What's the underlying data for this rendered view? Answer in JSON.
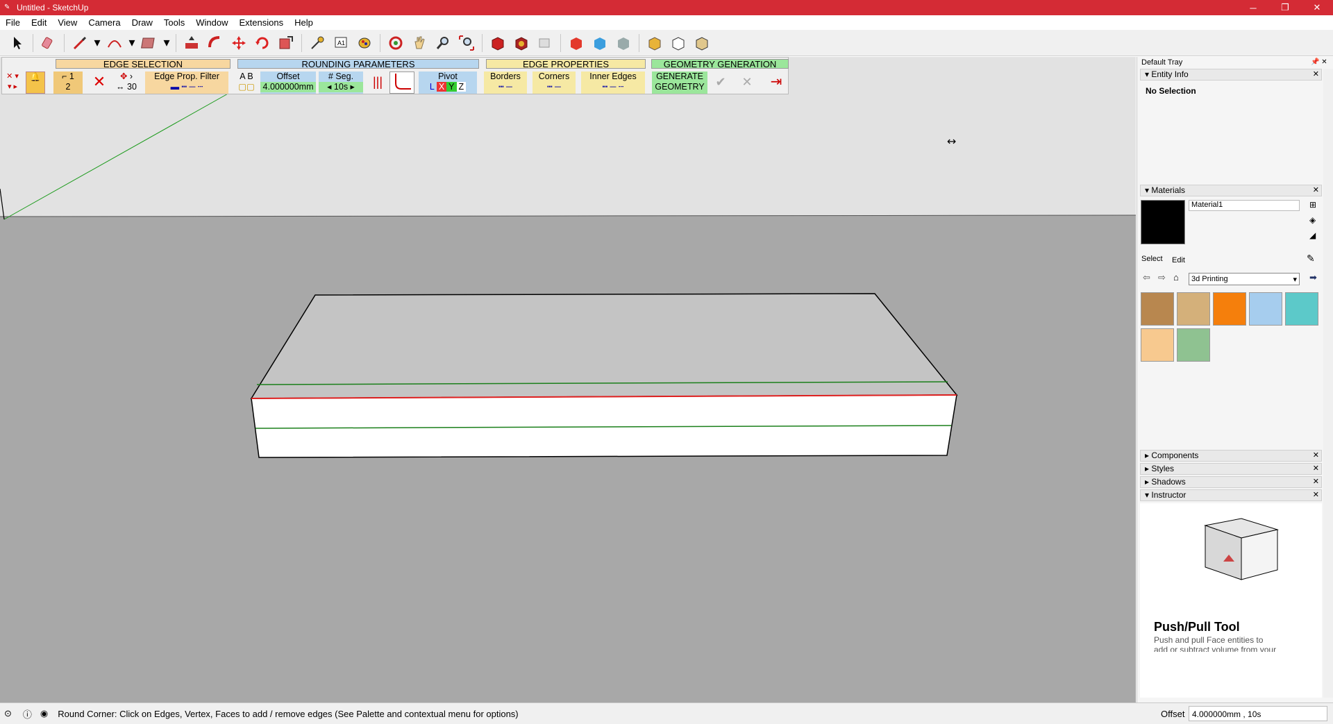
{
  "window": {
    "title": "Untitled - SketchUp",
    "minimize": "─",
    "restore": "❐",
    "close": "✕"
  },
  "menu": [
    "File",
    "Edit",
    "View",
    "Camera",
    "Draw",
    "Tools",
    "Window",
    "Extensions",
    "Help"
  ],
  "toolbar_icons": [
    "select-icon",
    "eraser-icon",
    "pencil-icon",
    "arc-icon",
    "rectangle-icon",
    "push-pull-icon",
    "follow-me-icon",
    "move-icon",
    "rotate-icon",
    "scale-icon",
    "tape-measure-icon",
    "text-icon",
    "paint-bucket-icon",
    "orbit-icon",
    "pan-icon",
    "zoom-icon",
    "zoom-extents-icon",
    "warehouse-icon",
    "extension-warehouse-icon",
    "layout-icon",
    "sketchup-red-icon",
    "sketchup-blue-icon",
    "sketchup-gray-icon",
    "solid-tools-icon",
    "section-icon",
    "view-icon"
  ],
  "round_corner": {
    "sections": {
      "edge_selection": "EDGE SELECTION",
      "rounding_parameters": "ROUNDING PARAMETERS",
      "edge_properties": "EDGE PROPERTIES",
      "geometry_generation": "GEOMETRY GENERATION"
    },
    "num1": "1",
    "num2": "2",
    "angle": "30",
    "edge_prop_filter": "Edge Prop. Filter",
    "a": "A",
    "b": "B",
    "offset_label": "Offset",
    "offset_value": "4.000000mm",
    "seg_label": "# Seg.",
    "seg_value": "10s",
    "pivot_label": "Pivot",
    "pivot_l": "L",
    "pivot_x": "X",
    "pivot_y": "Y",
    "pivot_z": "Z",
    "borders": "Borders",
    "corners": "Corners",
    "inner_edges": "Inner Edges",
    "generate_line1": "GENERATE",
    "generate_line2": "GEOMETRY"
  },
  "tray": {
    "title": "Default Tray",
    "entity_info": "Entity Info",
    "no_selection": "No Selection",
    "materials": "Materials",
    "material_name": "Material1",
    "tab_select": "Select",
    "tab_edit": "Edit",
    "library": "3d Printing",
    "swatches": [
      "#b8874f",
      "#d4b07a",
      "#f57f0c",
      "#a6cdee",
      "#5cc9c9",
      "#f7c98f",
      "#8fc291"
    ],
    "components": "Components",
    "styles": "Styles",
    "shadows": "Shadows",
    "instructor": "Instructor",
    "tool_title": "Push/Pull Tool",
    "tool_desc1": "Push and pull Face entities to",
    "tool_desc2": "add or subtract volume from your"
  },
  "status": {
    "message": "Round Corner: Click on Edges, Vertex, Faces to add / remove edges (See Palette and contextual menu for options)",
    "measure_label": "Offset",
    "measure_value": "4.000000mm , 10s"
  }
}
